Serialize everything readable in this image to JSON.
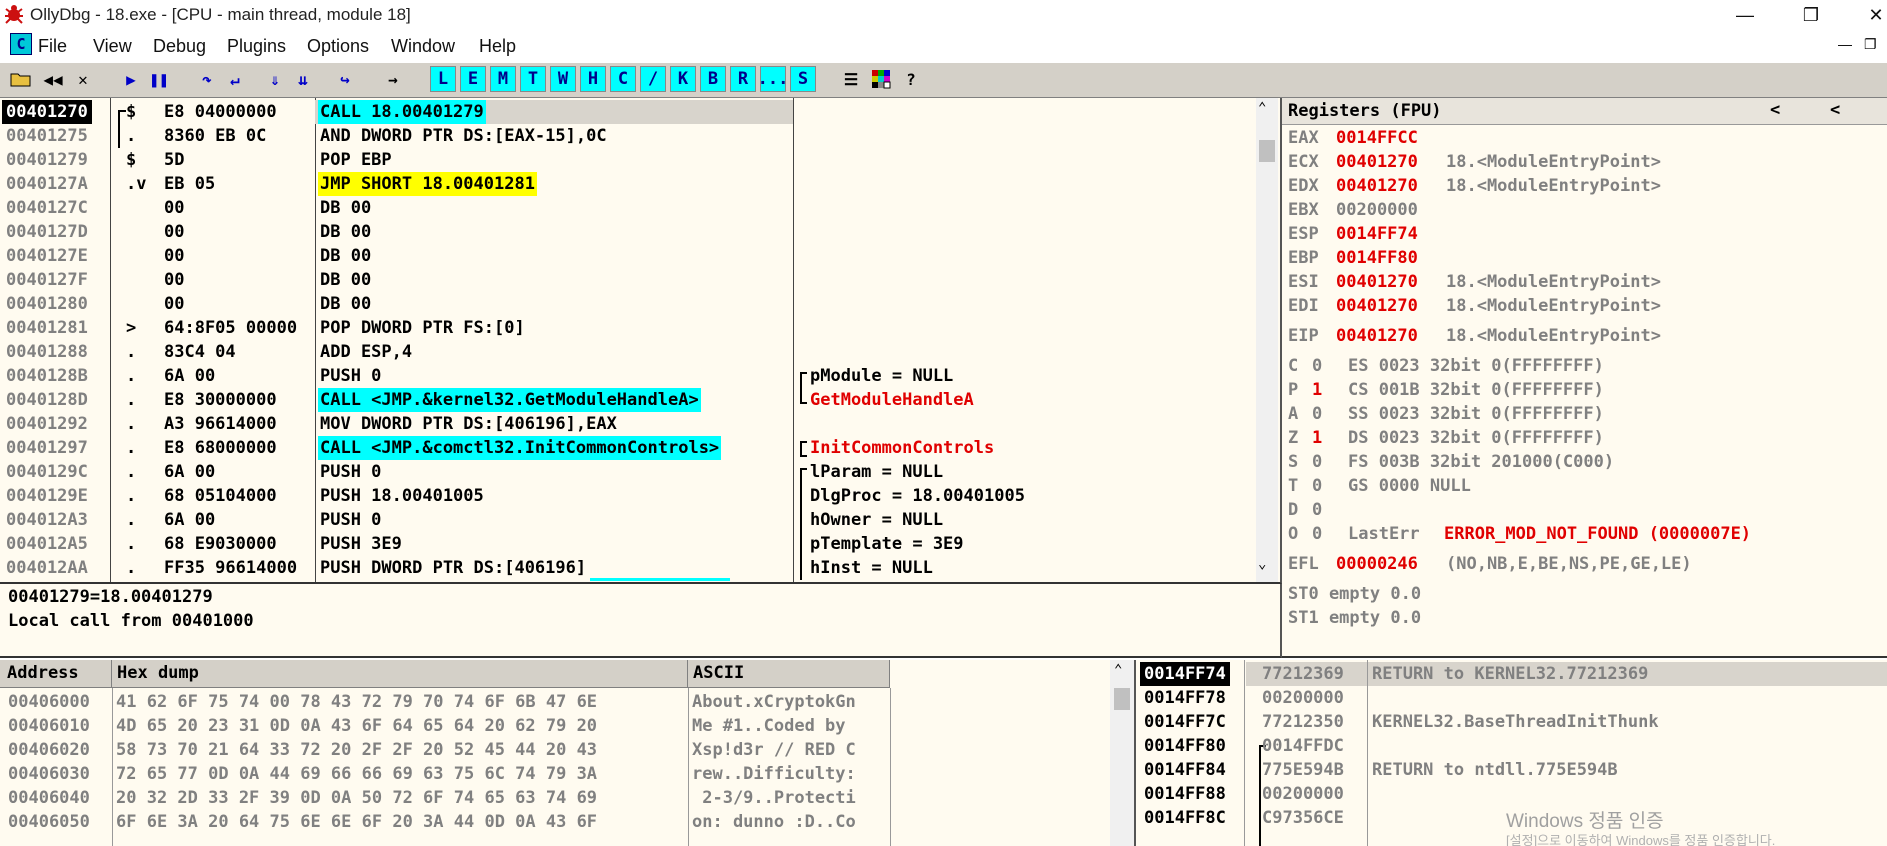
{
  "title": "OllyDbg - 18.exe - [CPU - main thread, module 18]",
  "menu": [
    "File",
    "View",
    "Debug",
    "Plugins",
    "Options",
    "Window",
    "Help"
  ],
  "toolbar_letters": [
    "L",
    "E",
    "M",
    "T",
    "W",
    "H",
    "C",
    "/",
    "K",
    "B",
    "R",
    "...",
    "S"
  ],
  "disasm": {
    "rows": [
      {
        "addr": "00401270",
        "mark": "$",
        "hex": "E8 04000000",
        "asm": "CALL 18.00401279",
        "cmt": "",
        "asm_bg": "cyan",
        "addr_sel": true
      },
      {
        "addr": "00401275",
        "mark": ".",
        "hex": "8360 EB 0C",
        "asm": "AND DWORD PTR DS:[EAX-15],0C",
        "cmt": ""
      },
      {
        "addr": "00401279",
        "mark": "$",
        "hex": "5D",
        "asm": "POP EBP",
        "cmt": ""
      },
      {
        "addr": "0040127A",
        "mark": ".v",
        "hex": "EB 05",
        "asm": "JMP SHORT 18.00401281",
        "cmt": "",
        "asm_bg": "yellow"
      },
      {
        "addr": "0040127C",
        "mark": "",
        "hex": "00",
        "asm": "DB 00",
        "cmt": ""
      },
      {
        "addr": "0040127D",
        "mark": "",
        "hex": "00",
        "asm": "DB 00",
        "cmt": ""
      },
      {
        "addr": "0040127E",
        "mark": "",
        "hex": "00",
        "asm": "DB 00",
        "cmt": ""
      },
      {
        "addr": "0040127F",
        "mark": "",
        "hex": "00",
        "asm": "DB 00",
        "cmt": ""
      },
      {
        "addr": "00401280",
        "mark": "",
        "hex": "00",
        "asm": "DB 00",
        "cmt": ""
      },
      {
        "addr": "00401281",
        "mark": ">",
        "hex": "64:8F05 00000",
        "asm": "POP DWORD PTR FS:[0]",
        "cmt": ""
      },
      {
        "addr": "00401288",
        "mark": ".",
        "hex": "83C4 04",
        "asm": "ADD ESP,4",
        "cmt": ""
      },
      {
        "addr": "0040128B",
        "mark": ".",
        "hex": "6A 00",
        "asm": "PUSH 0",
        "cmt": "pModule = NULL",
        "cmt_color": "normal",
        "brk": "top"
      },
      {
        "addr": "0040128D",
        "mark": ".",
        "hex": "E8 30000000",
        "asm": "CALL <JMP.&kernel32.GetModuleHandleA>",
        "cmt": "GetModuleHandleA",
        "cmt_color": "red",
        "asm_bg": "cyan",
        "brk": "bottom"
      },
      {
        "addr": "00401292",
        "mark": ".",
        "hex": "A3 96614000",
        "asm": "MOV DWORD PTR DS:[406196],EAX",
        "cmt": ""
      },
      {
        "addr": "00401297",
        "mark": ".",
        "hex": "E8 68000000",
        "asm": "CALL <JMP.&comctl32.InitCommonControls>",
        "cmt": "InitCommonControls",
        "cmt_color": "red",
        "asm_bg": "cyan",
        "brk": "single"
      },
      {
        "addr": "0040129C",
        "mark": ".",
        "hex": "6A 00",
        "asm": "PUSH 0",
        "cmt": "lParam = NULL",
        "brk": "top"
      },
      {
        "addr": "0040129E",
        "mark": ".",
        "hex": "68 05104000",
        "asm": "PUSH 18.00401005",
        "cmt": "DlgProc = 18.00401005",
        "brk": "mid"
      },
      {
        "addr": "004012A3",
        "mark": ".",
        "hex": "6A 00",
        "asm": "PUSH 0",
        "cmt": "hOwner = NULL",
        "brk": "mid"
      },
      {
        "addr": "004012A5",
        "mark": ".",
        "hex": "68 E9030000",
        "asm": "PUSH 3E9",
        "cmt": "pTemplate = 3E9",
        "brk": "mid"
      },
      {
        "addr": "004012AA",
        "mark": ".",
        "hex": "FF35 96614000",
        "asm": "PUSH DWORD PTR DS:[406196]",
        "cmt": "hInst = NULL",
        "brk": "mid"
      }
    ]
  },
  "info": {
    "line1": "00401279=18.00401279",
    "line2": "Local call from 00401000"
  },
  "registers": {
    "title": "Registers (FPU)",
    "regs": [
      {
        "name": "EAX",
        "val": "0014FFCC",
        "red": true,
        "desc": ""
      },
      {
        "name": "ECX",
        "val": "00401270",
        "red": true,
        "desc": "18.<ModuleEntryPoint>"
      },
      {
        "name": "EDX",
        "val": "00401270",
        "red": true,
        "desc": "18.<ModuleEntryPoint>"
      },
      {
        "name": "EBX",
        "val": "00200000",
        "red": false,
        "desc": ""
      },
      {
        "name": "ESP",
        "val": "0014FF74",
        "red": true,
        "desc": ""
      },
      {
        "name": "EBP",
        "val": "0014FF80",
        "red": true,
        "desc": ""
      },
      {
        "name": "ESI",
        "val": "00401270",
        "red": true,
        "desc": "18.<ModuleEntryPoint>"
      },
      {
        "name": "EDI",
        "val": "00401270",
        "red": true,
        "desc": "18.<ModuleEntryPoint>"
      }
    ],
    "eip": {
      "name": "EIP",
      "val": "00401270",
      "desc": "18.<ModuleEntryPoint>"
    },
    "flags": [
      {
        "f": "C",
        "v": "0",
        "red": false,
        "seg": "ES 0023 32bit 0(FFFFFFFF)"
      },
      {
        "f": "P",
        "v": "1",
        "red": true,
        "seg": "CS 001B 32bit 0(FFFFFFFF)"
      },
      {
        "f": "A",
        "v": "0",
        "red": false,
        "seg": "SS 0023 32bit 0(FFFFFFFF)"
      },
      {
        "f": "Z",
        "v": "1",
        "red": true,
        "seg": "DS 0023 32bit 0(FFFFFFFF)"
      },
      {
        "f": "S",
        "v": "0",
        "red": false,
        "seg": "FS 003B 32bit 201000(C000)"
      },
      {
        "f": "T",
        "v": "0",
        "red": false,
        "seg": "GS 0000 NULL"
      },
      {
        "f": "D",
        "v": "0",
        "red": false,
        "seg": ""
      },
      {
        "f": "O",
        "v": "0",
        "red": false,
        "seg": "LastErr ERROR_MOD_NOT_FOUND (0000007E)"
      }
    ],
    "efl": {
      "name": "EFL",
      "val": "00000246",
      "desc": "(NO,NB,E,BE,NS,PE,GE,LE)"
    },
    "st0": "ST0 empty 0.0",
    "st1": "ST1 empty 0.0"
  },
  "dump": {
    "headers": [
      "Address",
      "Hex dump",
      "ASCII"
    ],
    "rows": [
      {
        "addr": "00406000",
        "hex": "41 62 6F 75 74 00 78 43 72 79 70 74 6F 6B 47 6E",
        "ascii": "About.xCryptokGn"
      },
      {
        "addr": "00406010",
        "hex": "4D 65 20 23 31 0D 0A 43 6F 64 65 64 20 62 79 20",
        "ascii": "Me #1..Coded by "
      },
      {
        "addr": "00406020",
        "hex": "58 73 70 21 64 33 72 20 2F 2F 20 52 45 44 20 43",
        "ascii": "Xsp!d3r // RED C"
      },
      {
        "addr": "00406030",
        "hex": "72 65 77 0D 0A 44 69 66 66 69 63 75 6C 74 79 3A",
        "ascii": "rew..Difficulty:"
      },
      {
        "addr": "00406040",
        "hex": "20 32 2D 33 2F 39 0D 0A 50 72 6F 74 65 63 74 69",
        "ascii": " 2-3/9..Protecti"
      },
      {
        "addr": "00406050",
        "hex": "6F 6E 3A 20 64 75 6E 6E 6F 20 3A 44 0D 0A 43 6F",
        "ascii": "on: dunno :D..Co"
      }
    ]
  },
  "stack": {
    "rows": [
      {
        "addr": "0014FF74",
        "val": "77212369",
        "cmt": "RETURN to KERNEL32.77212369",
        "sel": true
      },
      {
        "addr": "0014FF78",
        "val": "00200000",
        "cmt": ""
      },
      {
        "addr": "0014FF7C",
        "val": "77212350",
        "cmt": "KERNEL32.BaseThreadInitThunk"
      },
      {
        "addr": "0014FF80",
        "val": "0014FFDC",
        "cmt": ""
      },
      {
        "addr": "0014FF84",
        "val": "775E594B",
        "cmt": "RETURN to ntdll.775E594B"
      },
      {
        "addr": "0014FF88",
        "val": "00200000",
        "cmt": ""
      },
      {
        "addr": "0014FF8C",
        "val": "C97356CE",
        "cmt": ""
      }
    ]
  },
  "watermark": {
    "line1": "Windows 정품 인증",
    "line2": "[설정]으로 이동하여 Windows를 정품 인증합니다."
  }
}
